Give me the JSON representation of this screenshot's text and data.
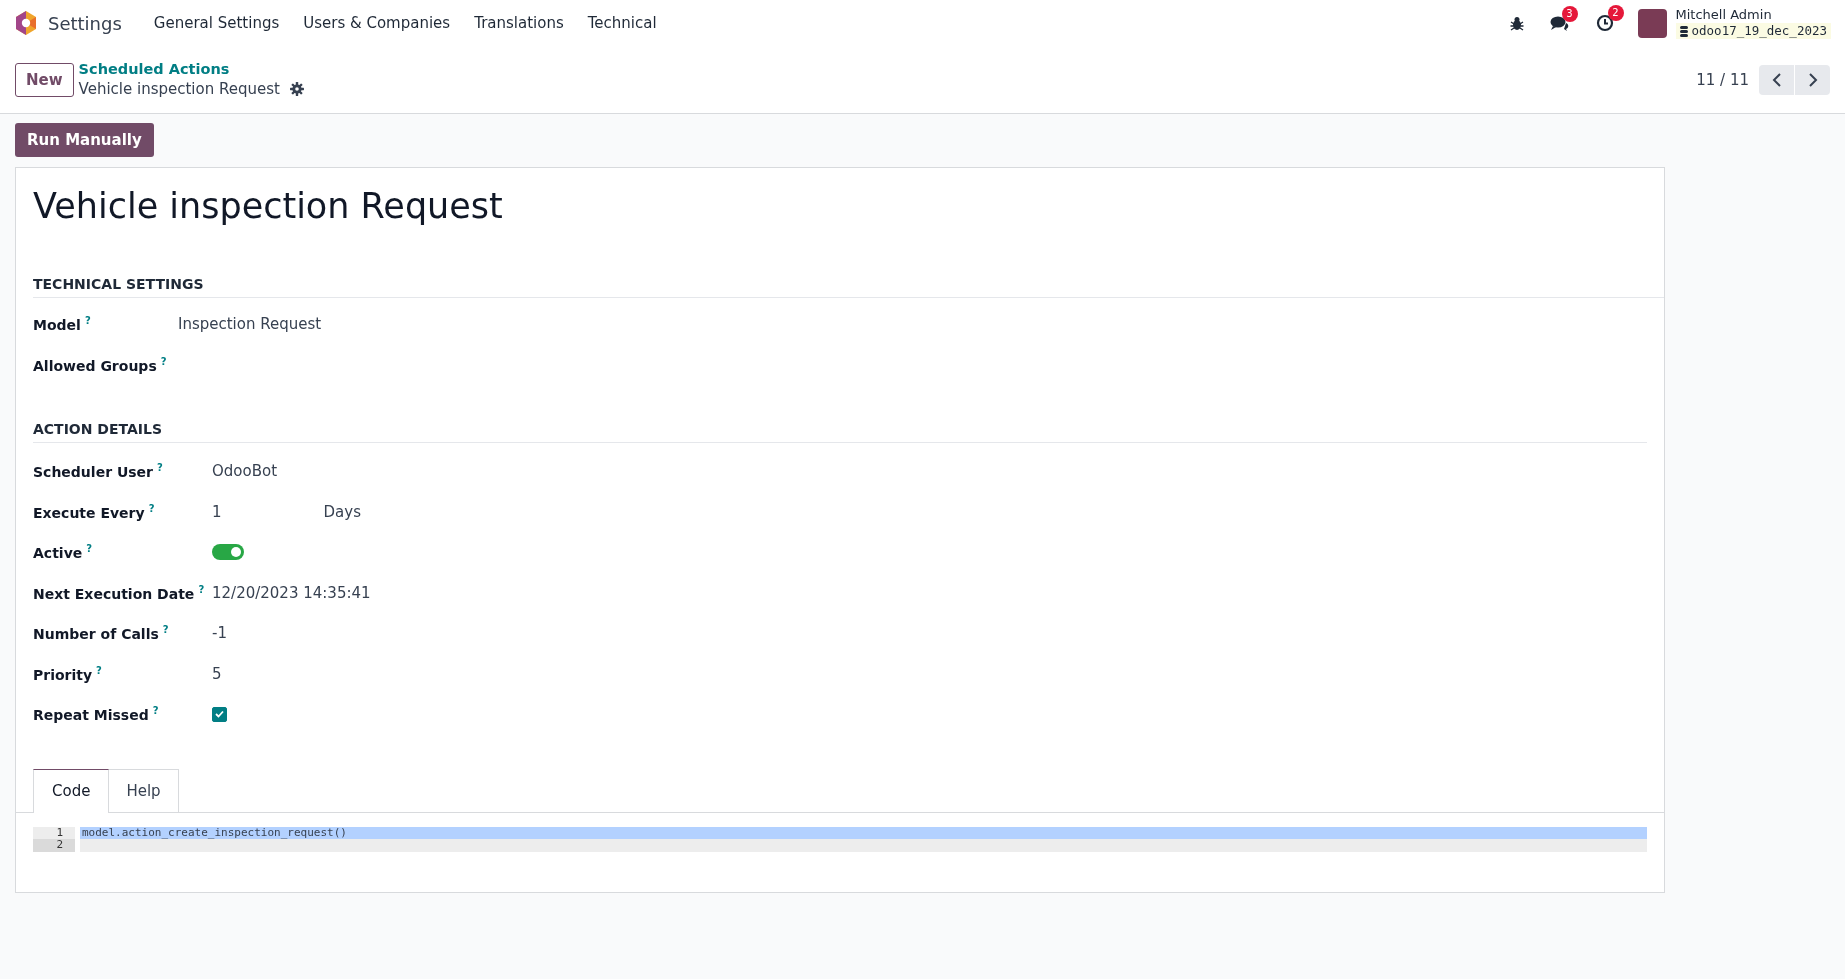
{
  "navbar": {
    "app_name": "Settings",
    "menus": [
      "General Settings",
      "Users & Companies",
      "Translations",
      "Technical"
    ],
    "systray": [
      {
        "kind": "bug"
      },
      {
        "kind": "chat",
        "badge": "3"
      },
      {
        "kind": "activity",
        "badge": "2"
      }
    ],
    "user": {
      "name": "Mitchell Admin",
      "database": "odoo17_19_dec_2023"
    }
  },
  "control_panel": {
    "new_button": "New",
    "breadcrumb": "Scheduled Actions",
    "record_title": "Vehicle inspection Request",
    "pager": "11 / 11"
  },
  "action_button": "Run Manually",
  "form": {
    "title": "Vehicle inspection Request",
    "sections": [
      {
        "heading": "TECHNICAL SETTINGS",
        "fields": [
          {
            "label": "Model",
            "tooltip": "?",
            "kind": "text",
            "value": "Inspection Request"
          },
          {
            "label": "Allowed Groups",
            "tooltip": "?",
            "kind": "empty"
          }
        ]
      },
      {
        "heading": "ACTION DETAILS",
        "fields": [
          {
            "label": "Scheduler User",
            "tooltip": "?",
            "kind": "text",
            "value": "OdooBot"
          },
          {
            "label": "Execute Every",
            "tooltip": "?",
            "kind": "interval",
            "value": "1",
            "unit": "Days"
          },
          {
            "label": "Active",
            "tooltip": "?",
            "kind": "toggle",
            "on": true
          },
          {
            "label": "Next Execution Date",
            "tooltip": "?",
            "kind": "text",
            "value": "12/20/2023 14:35:41"
          },
          {
            "label": "Number of Calls",
            "tooltip": "?",
            "kind": "text",
            "value": "-1"
          },
          {
            "label": "Priority",
            "tooltip": "?",
            "kind": "text",
            "value": "5"
          },
          {
            "label": "Repeat Missed",
            "tooltip": "?",
            "kind": "checkbox",
            "checked": true
          }
        ]
      }
    ],
    "tabs": [
      {
        "label": "Code",
        "selected": true
      },
      {
        "label": "Help",
        "selected": false
      }
    ],
    "code_lines": [
      {
        "number": "1",
        "text": "model.action_create_inspection_request()"
      },
      {
        "number": "2"
      }
    ]
  }
}
